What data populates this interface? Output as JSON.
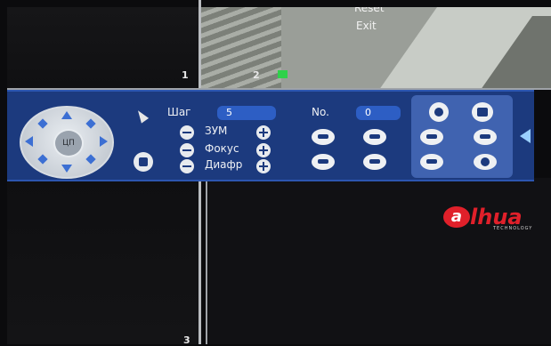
{
  "tiles": {
    "ch1": "1",
    "ch2": "2",
    "ch3": "3"
  },
  "context_menu": {
    "item_top": "Reset",
    "item_exit": "Exit"
  },
  "ptz": {
    "step_label": "Шаг",
    "step_value": "5",
    "zoom_label": "ЗУМ",
    "focus_label": "Фокус",
    "iris_label": "Диафр",
    "preset_label": "No.",
    "preset_value": "0",
    "dpad_center": "ЦП",
    "icons": {
      "row1": [
        "light-icon",
        "wiper-icon"
      ],
      "row2": [
        "preset-icon",
        "tour-icon",
        "pattern-icon",
        "scan-icon"
      ],
      "row3": [
        "pan-icon",
        "flip-icon",
        "reset-icon",
        "settings-gear-icon"
      ]
    }
  },
  "logo": {
    "brand": "alhua",
    "tagline": "TECHNOLOGY",
    "brand_color": "#e0202a"
  },
  "colors": {
    "panel": "#1c3a7e",
    "accent": "#2d5ec4",
    "recording": "#2fd14a"
  }
}
